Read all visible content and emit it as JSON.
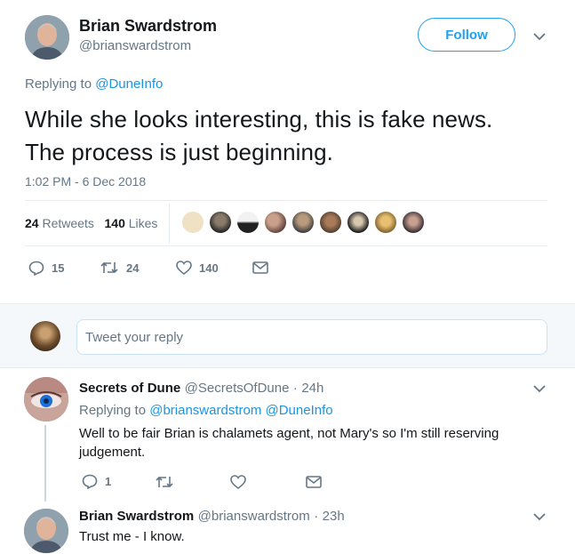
{
  "tweet": {
    "author": {
      "name": "Brian Swardstrom",
      "handle": "@brianswardstrom"
    },
    "follow_label": "Follow",
    "replying_prefix": "Replying to",
    "replying_to": "@DuneInfo",
    "text_line1": "While she looks interesting, this is fake news.",
    "text_line2": "The process is just beginning.",
    "timestamp": "1:02 PM - 6 Dec 2018",
    "stats": {
      "retweets_count": "24",
      "retweets_label": "Retweets",
      "likes_count": "140",
      "likes_label": "Likes"
    },
    "actions": {
      "replies": "15",
      "retweets": "24",
      "likes": "140"
    }
  },
  "reply_box": {
    "placeholder": "Tweet your reply"
  },
  "replies": [
    {
      "name": "Secrets of Dune",
      "handle": "@SecretsOfDune",
      "time": "24h",
      "replying_prefix": "Replying to",
      "replying_to_1": "@brianswardstrom",
      "replying_to_2": "@DuneInfo",
      "text_line1": "Well to be fair Brian is chalamets agent, not Mary's so I'm still reserving",
      "text_line2": "judgement.",
      "reply_count": "1"
    },
    {
      "name": "Brian Swardstrom",
      "handle": "@brianswardstrom",
      "time": "23h",
      "text": "Trust me - I know."
    }
  ],
  "separator": "·",
  "colors": {
    "accent": "#1da1f2",
    "link": "#1b95e0",
    "muted": "#657786",
    "divider": "#e6ecf0"
  },
  "icons": [
    "chevron-down-icon",
    "reply-icon",
    "retweet-icon",
    "heart-icon",
    "dm-envelope-icon"
  ]
}
